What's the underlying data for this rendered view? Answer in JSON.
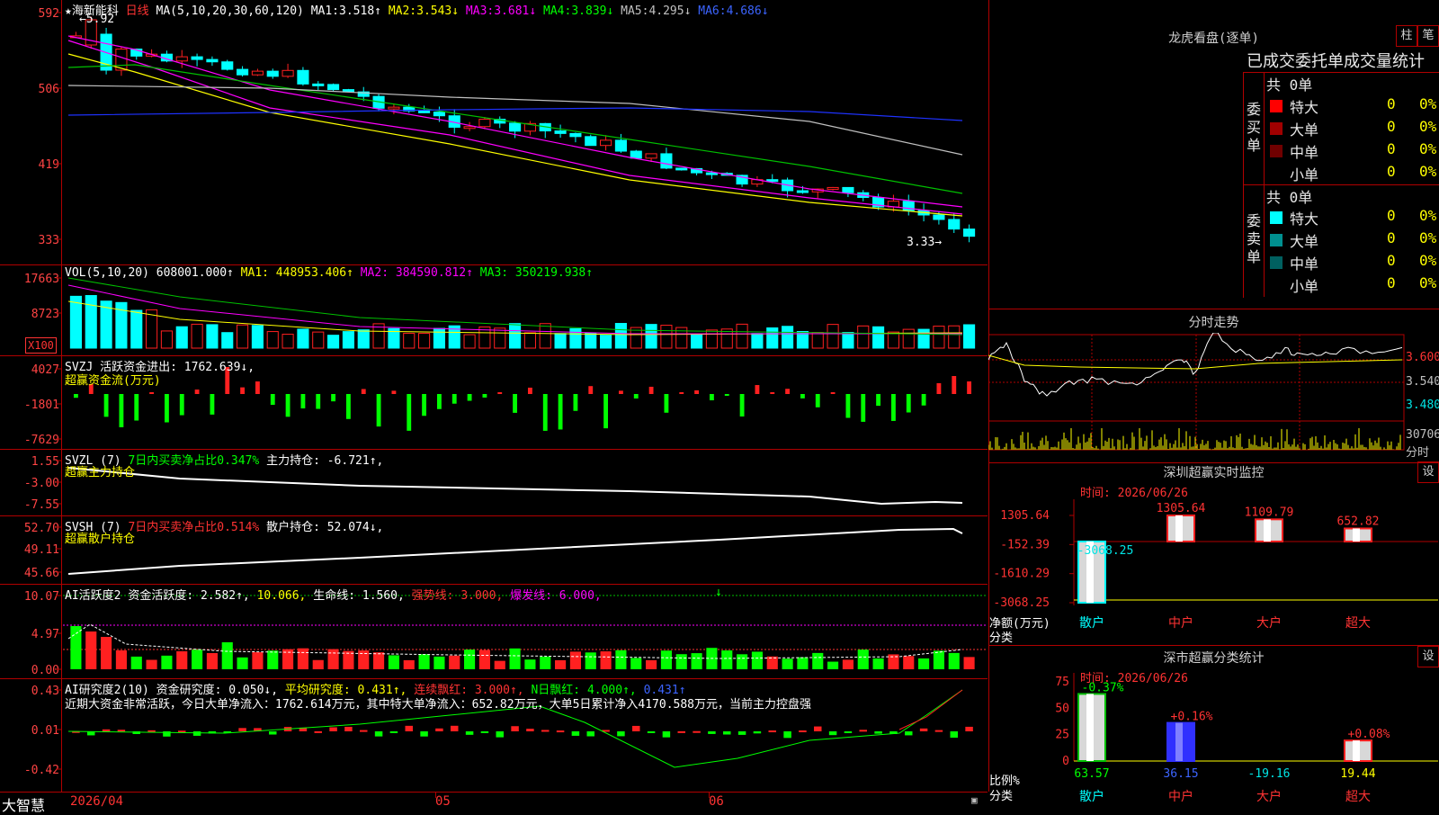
{
  "colors": {
    "up": "#ff2020",
    "down": "#00ffff",
    "grid": "#b00000",
    "ma1": "#ffff00",
    "ma2": "#ff00ff",
    "ma3": "#00c000",
    "ma4": "#c0c0c0",
    "ma5": "#1e32ff",
    "ma6": "#ffffff"
  },
  "stock": {
    "name": "★海新能科",
    "period": "日线",
    "ma_params": "MA(5,10,20,30,60,120)",
    "high_label": "←5.92",
    "low_label": "3.33→"
  },
  "price_panel": {
    "y_ticks": [
      "592",
      "506",
      "419",
      "333"
    ],
    "ma": [
      {
        "label": "MA1:",
        "val": "3.518↑"
      },
      {
        "label": "MA2:",
        "val": "3.543↓"
      },
      {
        "label": "MA3:",
        "val": "3.681↓"
      },
      {
        "label": "MA4:",
        "val": "3.839↓"
      },
      {
        "label": "MA5:",
        "val": "4.295↓"
      },
      {
        "label": "MA6:",
        "val": "4.686↓"
      }
    ]
  },
  "vol_panel": {
    "params": "VOL(5,10,20)",
    "value": "608001.000↑",
    "ma1": "MA1: 448953.406↑",
    "ma2": "MA2: 384590.812↑",
    "ma3": "MA3: 350219.938↑",
    "y_ticks": [
      "17663",
      "8723"
    ],
    "unit": "X100"
  },
  "svzj_panel": {
    "params": "SVZJ",
    "label": "活跃资金进出: 1762.639↓,",
    "subtitle": "超赢资金流(万元)",
    "y_ticks": [
      "4027",
      "-1801",
      "-7629"
    ]
  },
  "svzl_panel": {
    "params": "SVZL (7)",
    "ratio": "7日内买卖净占比0.347%",
    "label": "主力持仓: -6.721↑,",
    "subtitle": "超赢主力持仓",
    "y_ticks": [
      "1.55",
      "-3.00",
      "-7.55"
    ]
  },
  "svsh_panel": {
    "params": "SVSH (7)",
    "ratio": "7日内买卖净占比0.514%",
    "label": "散户持仓: 52.074↓,",
    "subtitle": "超赢散户持仓",
    "y_ticks": [
      "52.70",
      "49.11",
      "45.66"
    ]
  },
  "ai_active_panel": {
    "params": "AI活跃度2",
    "a": "资金活跃度: 2.582↑,",
    "b": "10.066,",
    "c": "生命线: 1.560,",
    "d": "强势线: 3.000,",
    "e": "爆发线: 6.000,",
    "y_ticks": [
      "10.07",
      "4.97",
      "0.00"
    ]
  },
  "ai_research_panel": {
    "params": "AI研究度2(10)",
    "a": "资金研究度: 0.050↓,",
    "b": "平均研究度: 0.431↑,",
    "c": "连续飘红: 3.000↑,",
    "d": "N日飘红: 4.000↑,",
    "e": "0.431↑",
    "note": "近期大资金非常活跃，今日大单净流入：1762.614万元，其中特大单净流入：652.82万元，大单5日累计净入4170.588万元，当前主力控盘强",
    "y_ticks": [
      "0.43",
      "0.01",
      "-0.42"
    ]
  },
  "x_axis": {
    "logo": "大智慧",
    "labels": [
      "2026/04",
      "05",
      "06"
    ]
  },
  "lhb": {
    "title": "龙虎看盘(逐单)",
    "btn1": "柱",
    "btn2": "笔",
    "subtitle": "已成交委托单成交量统计",
    "buy": {
      "side": [
        "委",
        "买",
        "单"
      ],
      "total": "共 0单",
      "rows": [
        {
          "name": "特大",
          "val": "0",
          "pct": "0%",
          "color": "#ff0000"
        },
        {
          "name": "大单",
          "val": "0",
          "pct": "0%",
          "color": "#a00000"
        },
        {
          "name": "中单",
          "val": "0",
          "pct": "0%",
          "color": "#700000"
        },
        {
          "name": "小单",
          "val": "0",
          "pct": "0%",
          "color": "#000000"
        }
      ]
    },
    "sell": {
      "side": [
        "委",
        "卖",
        "单"
      ],
      "total": "共 0单",
      "rows": [
        {
          "name": "特大",
          "val": "0",
          "pct": "0%",
          "color": "#00ffff"
        },
        {
          "name": "大单",
          "val": "0",
          "pct": "0%",
          "color": "#009090"
        },
        {
          "name": "中单",
          "val": "0",
          "pct": "0%",
          "color": "#006060"
        },
        {
          "name": "小单",
          "val": "0",
          "pct": "0%",
          "color": "#000000"
        }
      ]
    }
  },
  "intraday": {
    "title": "分时走势",
    "y_ticks": [
      "3.600",
      "3.540",
      "3.480"
    ],
    "vol_label": "30706",
    "vol_unit": "分时"
  },
  "sz_monitor": {
    "title": "深圳超赢实时监控",
    "btn": "设",
    "time": "时间: 2026/06/26",
    "y_ticks": [
      "1305.64",
      "-152.39",
      "-1610.29",
      "-3068.25"
    ],
    "ylabel": "净额(万元)",
    "xlabel": "分类",
    "cats": [
      "散户",
      "中户",
      "大户",
      "超大"
    ]
  },
  "chart_data": [
    {
      "type": "bar",
      "title": "深圳超赢实时监控",
      "categories": [
        "散户",
        "中户",
        "大户",
        "超大"
      ],
      "values": [
        -3068.25,
        1305.64,
        1109.79,
        652.82
      ],
      "ylabel": "净额(万元)",
      "xlabel": "分类",
      "ylim": [
        -3068.25,
        1305.64
      ]
    },
    {
      "type": "bar",
      "title": "深市超赢分类统计",
      "categories": [
        "散户",
        "中户",
        "大户",
        "超大"
      ],
      "values": [
        63.57,
        36.15,
        -19.16,
        19.44
      ],
      "annotations": [
        "-0.37%",
        "+0.16%",
        "",
        "+0.08%"
      ],
      "ylabel": "比例%",
      "xlabel": "分类",
      "ylim": [
        0,
        75
      ]
    }
  ],
  "sz_stats": {
    "title": "深市超赢分类统计",
    "btn": "设",
    "time": "时间: 2026/06/26",
    "y_ticks": [
      "75",
      "50",
      "25",
      "0"
    ],
    "ylabel": "比例%",
    "xlabel": "分类",
    "cats": [
      "散户",
      "中户",
      "大户",
      "超大"
    ],
    "bottom": [
      "63.57",
      "36.15",
      "-19.16",
      "19.44"
    ],
    "top": [
      "-0.37%",
      "+0.16%",
      "+0.08%"
    ],
    "sz_vals_labels": [
      "-3068.25",
      "1305.64",
      "1109.79",
      "652.82"
    ]
  }
}
